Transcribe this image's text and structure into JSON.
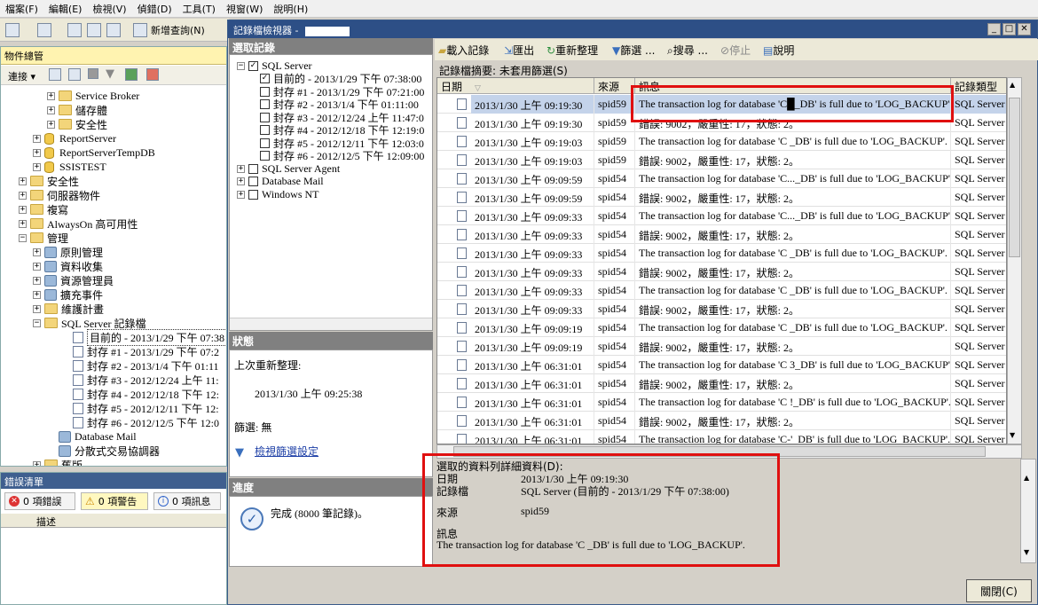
{
  "menu": [
    "檔案(F)",
    "編輯(E)",
    "檢視(V)",
    "偵錯(D)",
    "工具(T)",
    "視窗(W)",
    "說明(H)"
  ],
  "toolbar": {
    "new_query": "新增查詢(N)"
  },
  "object_explorer": {
    "title": "物件總管",
    "connect": "連接 ▾",
    "tree": [
      {
        "label": "Service Broker",
        "depth": 4,
        "icon": "folder",
        "exp": "+"
      },
      {
        "label": "儲存體",
        "depth": 4,
        "icon": "folder",
        "exp": "+"
      },
      {
        "label": "安全性",
        "depth": 4,
        "icon": "folder",
        "exp": "+"
      },
      {
        "label": "ReportServer",
        "depth": 3,
        "icon": "db",
        "exp": "+"
      },
      {
        "label": "ReportServerTempDB",
        "depth": 3,
        "icon": "db",
        "exp": "+"
      },
      {
        "label": "SSISTEST",
        "depth": 3,
        "icon": "db",
        "exp": "+"
      },
      {
        "label": "安全性",
        "depth": 2,
        "icon": "folder",
        "exp": "+"
      },
      {
        "label": "伺服器物件",
        "depth": 2,
        "icon": "folder",
        "exp": "+"
      },
      {
        "label": "複寫",
        "depth": 2,
        "icon": "folder",
        "exp": "+"
      },
      {
        "label": "AlwaysOn 高可用性",
        "depth": 2,
        "icon": "folder",
        "exp": "+"
      },
      {
        "label": "管理",
        "depth": 2,
        "icon": "folder",
        "exp": "−"
      },
      {
        "label": "原則管理",
        "depth": 3,
        "icon": "gear",
        "exp": "+"
      },
      {
        "label": "資料收集",
        "depth": 3,
        "icon": "gear",
        "exp": "+"
      },
      {
        "label": "資源管理員",
        "depth": 3,
        "icon": "gear",
        "exp": "+"
      },
      {
        "label": "擴充事件",
        "depth": 3,
        "icon": "gear",
        "exp": "+"
      },
      {
        "label": "維護計畫",
        "depth": 3,
        "icon": "folder",
        "exp": "+"
      },
      {
        "label": "SQL Server 記錄檔",
        "depth": 3,
        "icon": "folder",
        "exp": "−"
      },
      {
        "label": "目前的 - 2013/1/29 下午 07:38",
        "depth": 5,
        "icon": "log",
        "exp": "",
        "selected": true
      },
      {
        "label": "封存 #1 - 2013/1/29 下午 07:2",
        "depth": 5,
        "icon": "log",
        "exp": ""
      },
      {
        "label": "封存 #2 - 2013/1/4 下午 01:11",
        "depth": 5,
        "icon": "log",
        "exp": ""
      },
      {
        "label": "封存 #3 - 2012/12/24 上午 11:",
        "depth": 5,
        "icon": "log",
        "exp": ""
      },
      {
        "label": "封存 #4 - 2012/12/18 下午 12:",
        "depth": 5,
        "icon": "log",
        "exp": ""
      },
      {
        "label": "封存 #5 - 2012/12/11 下午 12:",
        "depth": 5,
        "icon": "log",
        "exp": ""
      },
      {
        "label": "封存 #6 - 2012/12/5 下午 12:0",
        "depth": 5,
        "icon": "log",
        "exp": ""
      },
      {
        "label": "Database Mail",
        "depth": 4,
        "icon": "gear",
        "exp": ""
      },
      {
        "label": "分散式交易協調器",
        "depth": 4,
        "icon": "gear",
        "exp": ""
      },
      {
        "label": "舊版",
        "depth": 3,
        "icon": "folder",
        "exp": "+"
      }
    ]
  },
  "error_list": {
    "title": "錯誤清單",
    "errors": "0 項錯誤",
    "warnings": "0 項警告",
    "messages": "0 項訊息",
    "col_desc": "描述"
  },
  "viewer": {
    "title": "記錄檔檢視器 -",
    "select_title": "選取記錄",
    "select_tree": [
      {
        "label": "SQL Server",
        "depth": 0,
        "exp": "−",
        "checked": true
      },
      {
        "label": "目前的 - 2013/1/29 下午 07:38:00",
        "depth": 1,
        "exp": "",
        "checked": true
      },
      {
        "label": "封存 #1 - 2013/1/29 下午 07:21:00",
        "depth": 1,
        "exp": "",
        "checked": false
      },
      {
        "label": "封存 #2 - 2013/1/4 下午 01:11:00",
        "depth": 1,
        "exp": "",
        "checked": false
      },
      {
        "label": "封存 #3 - 2012/12/24 上午 11:47:0",
        "depth": 1,
        "exp": "",
        "checked": false
      },
      {
        "label": "封存 #4 - 2012/12/18 下午 12:19:0",
        "depth": 1,
        "exp": "",
        "checked": false
      },
      {
        "label": "封存 #5 - 2012/12/11 下午 12:03:0",
        "depth": 1,
        "exp": "",
        "checked": false
      },
      {
        "label": "封存 #6 - 2012/12/5 下午 12:09:00",
        "depth": 1,
        "exp": "",
        "checked": false
      },
      {
        "label": "SQL Server Agent",
        "depth": 0,
        "exp": "+",
        "checked": false
      },
      {
        "label": "Database Mail",
        "depth": 0,
        "exp": "+",
        "checked": false
      },
      {
        "label": "Windows NT",
        "depth": 0,
        "exp": "+",
        "checked": false
      }
    ],
    "state_title": "狀態",
    "last_refresh_label": "上次重新整理:",
    "last_refresh_value": "2013/1/30 上午 09:25:38",
    "filter_label": "篩選: 無",
    "view_filter_link": "檢視篩選設定",
    "progress_title": "進度",
    "progress_text": "完成 (8000 筆記錄)。",
    "tools": {
      "load": "載入記錄",
      "export": "匯出",
      "refresh": "重新整理",
      "filter": "篩選 ...",
      "search": "搜尋 ...",
      "stop": "停止",
      "help": "說明"
    },
    "summary": "記錄檔摘要: 未套用篩選(S)",
    "columns": {
      "date": "日期",
      "source": "來源",
      "message": "訊息",
      "log_type": "記錄類型",
      "extra": "記"
    },
    "rows": [
      {
        "date": "2013/1/30 上午 09:19:30",
        "src": "spid59",
        "msg": "The transaction log for database 'C█_DB' is full due to 'LOG_BACKUP'.",
        "type": "SQL Server",
        "x": "E",
        "sel": true
      },
      {
        "date": "2013/1/30 上午 09:19:30",
        "src": "spid59",
        "msg": "錯誤: 9002，嚴重性: 17，狀態: 2。",
        "type": "SQL Server",
        "x": "E"
      },
      {
        "date": "2013/1/30 上午 09:19:03",
        "src": "spid59",
        "msg": "The transaction log for database 'C   _DB' is full due to 'LOG_BACKUP'.",
        "type": "SQL Server",
        "x": "E"
      },
      {
        "date": "2013/1/30 上午 09:19:03",
        "src": "spid59",
        "msg": "錯誤: 9002，嚴重性: 17，狀態: 2。",
        "type": "SQL Server",
        "x": "E"
      },
      {
        "date": "2013/1/30 上午 09:09:59",
        "src": "spid54",
        "msg": "The transaction log for database 'C..._DB' is full due to 'LOG_BACKUP'.",
        "type": "SQL Server",
        "x": "E"
      },
      {
        "date": "2013/1/30 上午 09:09:59",
        "src": "spid54",
        "msg": "錯誤: 9002，嚴重性: 17，狀態: 2。",
        "type": "SQL Server",
        "x": "E"
      },
      {
        "date": "2013/1/30 上午 09:09:33",
        "src": "spid54",
        "msg": "The transaction log for database 'C..._DB' is full due to 'LOG_BACKUP'.",
        "type": "SQL Server",
        "x": "E"
      },
      {
        "date": "2013/1/30 上午 09:09:33",
        "src": "spid54",
        "msg": "錯誤: 9002，嚴重性: 17，狀態: 2。",
        "type": "SQL Server",
        "x": "E"
      },
      {
        "date": "2013/1/30 上午 09:09:33",
        "src": "spid54",
        "msg": "The transaction log for database 'C   _DB' is full due to 'LOG_BACKUP'.",
        "type": "SQL Server",
        "x": "E"
      },
      {
        "date": "2013/1/30 上午 09:09:33",
        "src": "spid54",
        "msg": "錯誤: 9002，嚴重性: 17，狀態: 2。",
        "type": "SQL Server",
        "x": "E"
      },
      {
        "date": "2013/1/30 上午 09:09:33",
        "src": "spid54",
        "msg": "The transaction log for database 'C   _DB' is full due to 'LOG_BACKUP'.",
        "type": "SQL Server",
        "x": "E"
      },
      {
        "date": "2013/1/30 上午 09:09:33",
        "src": "spid54",
        "msg": "錯誤: 9002，嚴重性: 17，狀態: 2。",
        "type": "SQL Server",
        "x": "E"
      },
      {
        "date": "2013/1/30 上午 09:09:19",
        "src": "spid54",
        "msg": "The transaction log for database 'C   _DB' is full due to 'LOG_BACKUP'.",
        "type": "SQL Server",
        "x": "E"
      },
      {
        "date": "2013/1/30 上午 09:09:19",
        "src": "spid54",
        "msg": "錯誤: 9002，嚴重性: 17，狀態: 2。",
        "type": "SQL Server",
        "x": "E"
      },
      {
        "date": "2013/1/30 上午 06:31:01",
        "src": "spid54",
        "msg": "The transaction log for database 'C  3_DB' is full due to 'LOG_BACKUP'.",
        "type": "SQL Server",
        "x": "E"
      },
      {
        "date": "2013/1/30 上午 06:31:01",
        "src": "spid54",
        "msg": "錯誤: 9002，嚴重性: 17，狀態: 2。",
        "type": "SQL Server",
        "x": "E"
      },
      {
        "date": "2013/1/30 上午 06:31:01",
        "src": "spid54",
        "msg": "The transaction log for database 'C  !_DB' is full due to 'LOG_BACKUP'.",
        "type": "SQL Server",
        "x": "E"
      },
      {
        "date": "2013/1/30 上午 06:31:01",
        "src": "spid54",
        "msg": "錯誤: 9002，嚴重性: 17，狀態: 2。",
        "type": "SQL Server",
        "x": "E"
      },
      {
        "date": "2013/1/30 上午 06:31:01",
        "src": "spid54",
        "msg": "The transaction log for database 'C-'_DB' is full due to 'LOG_BACKUP'.",
        "type": "SQL Server",
        "x": "E"
      }
    ],
    "detail": {
      "title": "選取的資料列詳細資料(D):",
      "date_label": "日期",
      "date_value": "2013/1/30 上午 09:19:30",
      "log_label": "記錄檔",
      "log_value": "SQL Server (目前的 - 2013/1/29 下午 07:38:00)",
      "source_label": "來源",
      "source_value": "spid59",
      "message_label": "訊息",
      "message_value": "The transaction log for database 'C  _DB' is full due to 'LOG_BACKUP'."
    },
    "close": "關閉(C)"
  },
  "colors": {
    "highlight_box": "#e01010",
    "title_bar": "#2d4f86",
    "selected_row": "#c4d3ea"
  }
}
